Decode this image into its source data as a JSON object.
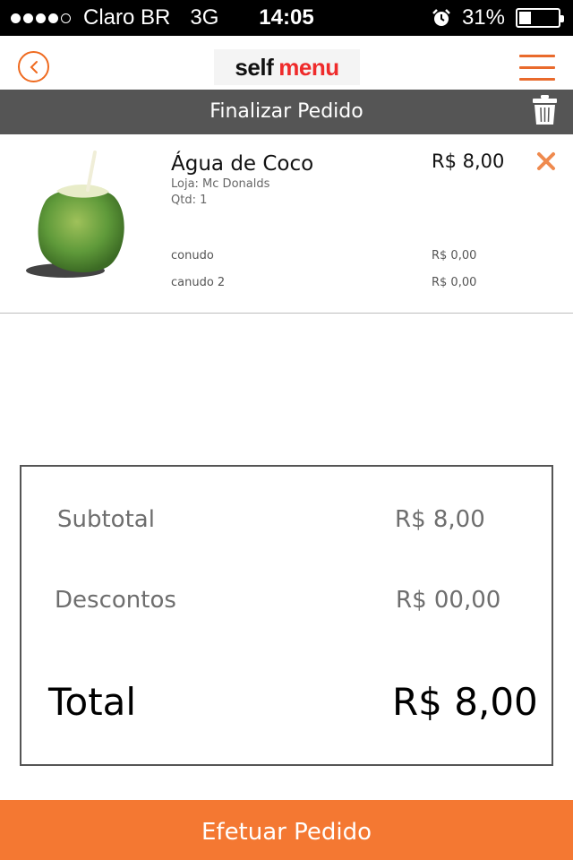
{
  "status_bar": {
    "carrier": "Claro BR",
    "network": "3G",
    "time": "14:05",
    "battery_percent": "31%",
    "battery_level": 0.31,
    "signal_bars_filled": 4,
    "signal_bars_total": 5,
    "alarm_icon": "alarm-clock-icon"
  },
  "header": {
    "back_icon": "chevron-left-circle-icon",
    "logo_self": "self",
    "logo_menu": "menu",
    "menu_icon": "hamburger-menu-icon",
    "accent_color": "#ef6a1f"
  },
  "title_bar": {
    "title": "Finalizar Pedido",
    "trash_icon": "trash-icon",
    "background": "#555555"
  },
  "order_item": {
    "name": "Água de Coco",
    "store": "Loja: Mc Donalds",
    "qty": "Qtd: 1",
    "price": "R$ 8,00",
    "remove_icon": "close-x-icon",
    "image": "coconut-water-image",
    "extras": [
      {
        "name": "conudo",
        "price": "R$ 0,00"
      },
      {
        "name": "canudo 2",
        "price": "R$ 0,00"
      }
    ]
  },
  "summary": {
    "subtotal_label": "Subtotal",
    "subtotal_value": "R$ 8,00",
    "discounts_label": "Descontos",
    "discounts_value": "R$ 00,00",
    "total_label": "Total",
    "total_value": "R$ 8,00"
  },
  "footer": {
    "submit_label": "Efetuar Pedido",
    "button_color": "#f47832"
  }
}
